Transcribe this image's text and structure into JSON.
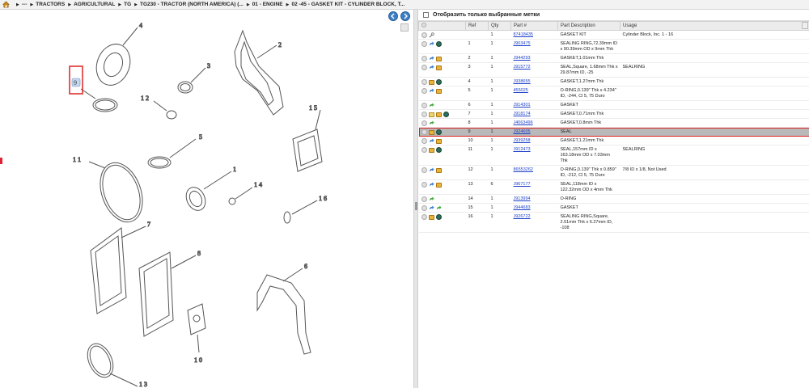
{
  "breadcrumb": {
    "items": [
      "---",
      "TRACTORS",
      "AGRICULTURAL",
      "TG",
      "TG230 - TRACTOR (NORTH AMERICA) (...",
      "01 - ENGINE",
      "02 -45 - GASKET KIT - CYLINDER BLOCK, T..."
    ]
  },
  "diagram": {
    "callouts": [
      "1",
      "2",
      "3",
      "4",
      "5",
      "6",
      "7",
      "8",
      "9",
      "10",
      "11",
      "12",
      "13",
      "14",
      "15",
      "16"
    ]
  },
  "filter": {
    "label": "Отобразить только выбранные метки",
    "checked": false
  },
  "table": {
    "headers": [
      "",
      "Ref",
      "Qty",
      "Part #",
      "Part Description",
      "Usage"
    ],
    "rows": [
      {
        "icons": [
          "circle",
          "wrench"
        ],
        "ref": "",
        "qty": "1",
        "part": "87418435",
        "desc": "GASKET KIT",
        "usage": "Cylinder Block, Inc. 1 - 16"
      },
      {
        "icons": [
          "circle",
          "arrow-blue",
          "globe"
        ],
        "ref": "1",
        "qty": "1",
        "part": "J903475",
        "desc": "SEALING RING,72.39mm ID x 90.39mm OD x 9mm Thk",
        "usage": ""
      },
      {
        "icons": [
          "circle",
          "arrow-blue",
          "box"
        ],
        "ref": "2",
        "qty": "1",
        "part": "J944293",
        "desc": "GASKET,1.01mm Thk",
        "usage": ""
      },
      {
        "icons": [
          "circle",
          "arrow-blue",
          "box"
        ],
        "ref": "3",
        "qty": "1",
        "part": "J915772",
        "desc": "SEAL,Square, 1.68mm Thk x 29.87mm ID, -25",
        "usage": "SEALRING"
      },
      {
        "icons": [
          "circle",
          "box",
          "globe"
        ],
        "ref": "4",
        "qty": "1",
        "part": "J938655",
        "desc": "GASKET,1.27mm Thk",
        "usage": ""
      },
      {
        "icons": [
          "circle",
          "arrow-blue",
          "box"
        ],
        "ref": "5",
        "qty": "1",
        "part": "455025",
        "desc": "O-RING,0.139\" Thk x 4.234\" ID, -244, Cl 5, 75 Duro",
        "usage": ""
      },
      {
        "icons": [
          "circle",
          "arrow-green"
        ],
        "ref": "6",
        "qty": "1",
        "part": "J914301",
        "desc": "GASKET",
        "usage": ""
      },
      {
        "icons": [
          "circle",
          "folder",
          "box",
          "globe"
        ],
        "ref": "7",
        "qty": "1",
        "part": "J918174",
        "desc": "GASKET,0.71mm Thk",
        "usage": ""
      },
      {
        "icons": [
          "circle",
          "arrow-green"
        ],
        "ref": "8",
        "qty": "1",
        "part": "J4063496",
        "desc": "GASKET,0.8mm Thk",
        "usage": ""
      },
      {
        "icons": [
          "circle",
          "box",
          "globe"
        ],
        "ref": "9",
        "qty": "1",
        "part": "J924605",
        "desc": "SEAL",
        "usage": "",
        "selected": true
      },
      {
        "icons": [
          "circle",
          "arrow-blue",
          "box"
        ],
        "ref": "10",
        "qty": "1",
        "part": "J939258",
        "desc": "GASKET,1.21mm Thk",
        "usage": ""
      },
      {
        "icons": [
          "circle",
          "box",
          "globe"
        ],
        "ref": "11",
        "qty": "1",
        "part": "J912473",
        "desc": "SEAL,157mm ID x 163.18mm OD x 7.03mm Thk",
        "usage": "SEALRING"
      },
      {
        "icons": [
          "circle",
          "arrow-blue",
          "box"
        ],
        "ref": "12",
        "qty": "1",
        "part": "86553262",
        "desc": "O-RING,0.139\" Thk x 0.859\" ID, -212, Cl 5, 75 Duro",
        "usage": "7/8 ID x 1/8, Not Used"
      },
      {
        "icons": [
          "circle",
          "arrow-blue",
          "box"
        ],
        "ref": "13",
        "qty": "6",
        "part": "J967177",
        "desc": "SEAL,118mm ID x 122.32mm OD x 4mm Thk",
        "usage": ""
      },
      {
        "icons": [
          "circle",
          "arrow-green"
        ],
        "ref": "14",
        "qty": "1",
        "part": "J913994",
        "desc": "O-RING",
        "usage": ""
      },
      {
        "icons": [
          "circle",
          "arrow-blue",
          "arrow-green"
        ],
        "ref": "15",
        "qty": "1",
        "part": "J944683",
        "desc": "GASKET",
        "usage": ""
      },
      {
        "icons": [
          "circle",
          "box",
          "globe"
        ],
        "ref": "16",
        "qty": "1",
        "part": "J926722",
        "desc": "SEALING RING,Square, 2.51mm Thk x 6.27mm ID, -108",
        "usage": ""
      }
    ]
  },
  "colors": {
    "link": "#1a3fc9",
    "selected_row": "#b9b9b9",
    "highlight": "#dd2222",
    "nav_button": "#3d7fc4"
  }
}
